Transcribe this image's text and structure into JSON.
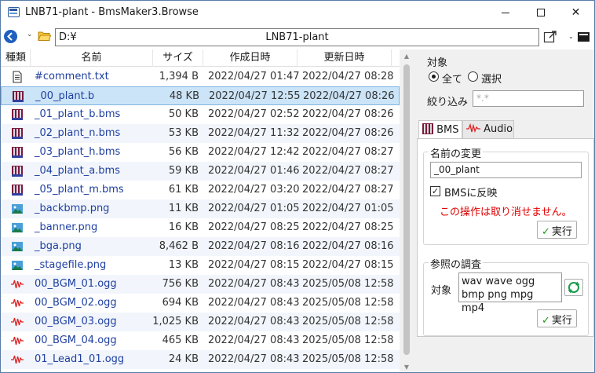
{
  "window": {
    "title": "LNB71-plant - BmsMaker3.Browse",
    "minimize": "",
    "maximize": "",
    "close": "✕"
  },
  "pathbar": {
    "back_icon": "arrow-left",
    "dropdown": "⌄",
    "drive": "D:¥",
    "folder": "LNB71-plant",
    "menu": "⌄"
  },
  "table": {
    "columns": [
      "種類",
      "名前",
      "サイズ",
      "作成日時",
      "更新日時"
    ],
    "rows": [
      {
        "icon": "text",
        "name": "#comment.txt",
        "size": "1,394 B",
        "created": "2022/04/27 01:47",
        "updated": "2022/04/27 08:28"
      },
      {
        "icon": "bms",
        "name": "_00_plant.b",
        "size": "48 KB",
        "created": "2022/04/27 12:55",
        "updated": "2022/04/27 08:26"
      },
      {
        "icon": "bms",
        "name": "_01_plant_b.bms",
        "size": "50 KB",
        "created": "2022/04/27 02:52",
        "updated": "2022/04/27 08:26"
      },
      {
        "icon": "bms",
        "name": "_02_plant_n.bms",
        "size": "53 KB",
        "created": "2022/04/27 11:32",
        "updated": "2022/04/27 08:26"
      },
      {
        "icon": "bms",
        "name": "_03_plant_h.bms",
        "size": "56 KB",
        "created": "2022/04/27 12:42",
        "updated": "2022/04/27 08:27"
      },
      {
        "icon": "bms",
        "name": "_04_plant_a.bms",
        "size": "59 KB",
        "created": "2022/04/27 01:46",
        "updated": "2022/04/27 08:27"
      },
      {
        "icon": "bms",
        "name": "_05_plant_m.bms",
        "size": "61 KB",
        "created": "2022/04/27 03:20",
        "updated": "2022/04/27 08:27"
      },
      {
        "icon": "image",
        "name": "_backbmp.png",
        "size": "11 KB",
        "created": "2022/04/27 01:05",
        "updated": "2022/04/27 01:05"
      },
      {
        "icon": "image",
        "name": "_banner.png",
        "size": "16 KB",
        "created": "2022/04/27 08:25",
        "updated": "2022/04/27 08:25"
      },
      {
        "icon": "image",
        "name": "_bga.png",
        "size": "8,462 B",
        "created": "2022/04/27 08:16",
        "updated": "2022/04/27 08:16"
      },
      {
        "icon": "image",
        "name": "_stagefile.png",
        "size": "13 KB",
        "created": "2022/04/27 08:15",
        "updated": "2022/04/27 08:15"
      },
      {
        "icon": "audio",
        "name": "00_BGM_01.ogg",
        "size": "756 KB",
        "created": "2022/04/27 08:43",
        "updated": "2025/05/08 12:58"
      },
      {
        "icon": "audio",
        "name": "00_BGM_02.ogg",
        "size": "694 KB",
        "created": "2022/04/27 08:43",
        "updated": "2025/05/08 12:58"
      },
      {
        "icon": "audio",
        "name": "00_BGM_03.ogg",
        "size": "1,025 KB",
        "created": "2022/04/27 08:43",
        "updated": "2025/05/08 12:58"
      },
      {
        "icon": "audio",
        "name": "00_BGM_04.ogg",
        "size": "465 KB",
        "created": "2022/04/27 08:43",
        "updated": "2025/05/08 12:58"
      },
      {
        "icon": "audio",
        "name": "01_Lead1_01.ogg",
        "size": "24 KB",
        "created": "2022/04/27 08:43",
        "updated": "2025/05/08 12:58"
      }
    ],
    "selected_index": 1
  },
  "target": {
    "label": "対象",
    "all": "全て",
    "select": "選択",
    "selected": "all",
    "filter_label": "絞り込み",
    "filter_placeholder": "*.*"
  },
  "tabs": {
    "bms": "BMS",
    "audio": "Audio",
    "active": "bms"
  },
  "rename": {
    "label": "名前の変更",
    "value": "_00_plant",
    "reflect_label": "BMSに反映",
    "reflect_checked": true,
    "warning": "この操作は取り消せません。",
    "execute": "実行"
  },
  "reference": {
    "label": "参照の調査",
    "target_label": "対象",
    "extensions": "wav wave ogg bmp png mpg mp4",
    "execute": "実行"
  },
  "colors": {
    "selection": "#cce4f7",
    "link": "#1e3fa0",
    "warning": "#e00000",
    "accent": "#1f5fbf"
  }
}
